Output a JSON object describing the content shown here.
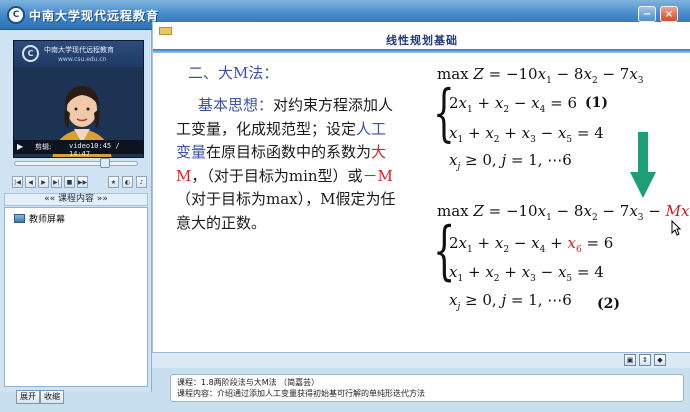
{
  "window": {
    "logo_text": "C",
    "title": "中南大学现代远程教育",
    "minimize_glyph": "−",
    "close_glyph": "×"
  },
  "video": {
    "logo_text": "C",
    "banner_title": "中南大学现代远程教育",
    "banner_url": "www.csu.edu.cn",
    "clip_label": "剪辑:",
    "time": "video10:45 / 14:47",
    "progress_fraction": 0.73
  },
  "controls": {
    "buttons": [
      "|◀",
      "◀",
      "▶",
      "▶|",
      "■",
      "▶▶",
      "★",
      "◐",
      "♪"
    ]
  },
  "outline": {
    "header": "«« 课程内容 »»",
    "items": [
      {
        "label": "教师屏幕",
        "icon": "monitor-icon"
      }
    ]
  },
  "slide": {
    "title": "线性规划基础",
    "heading": "二、大M法：",
    "para_lead": "基本思想：",
    "para_1": "对约束方程添加人工变量，化成规范型；设定",
    "para_hl": "人工变量",
    "para_2": "在原目标函数中的系数为",
    "para_bigm": "大M",
    "para_3": "，（对于目标为min型）或",
    "para_negm": "－M",
    "para_4": "（对于目标为max），M假定为任意大的正数。",
    "tag1": "(1)",
    "tag2": "(2)"
  },
  "status": {
    "line1": "课程：1.8两阶段法与大M法 （简嘉芸）",
    "line2": "课程内容：介绍通过添加人工变量获得初始基可行解的单纯形迭代方法"
  },
  "bottom": {
    "expand": "展开",
    "collapse": "收缩"
  },
  "colors": {
    "accent_blue": "#3b52a3",
    "highlight_red": "#e02020",
    "arrow_green": "#1e9e76"
  }
}
